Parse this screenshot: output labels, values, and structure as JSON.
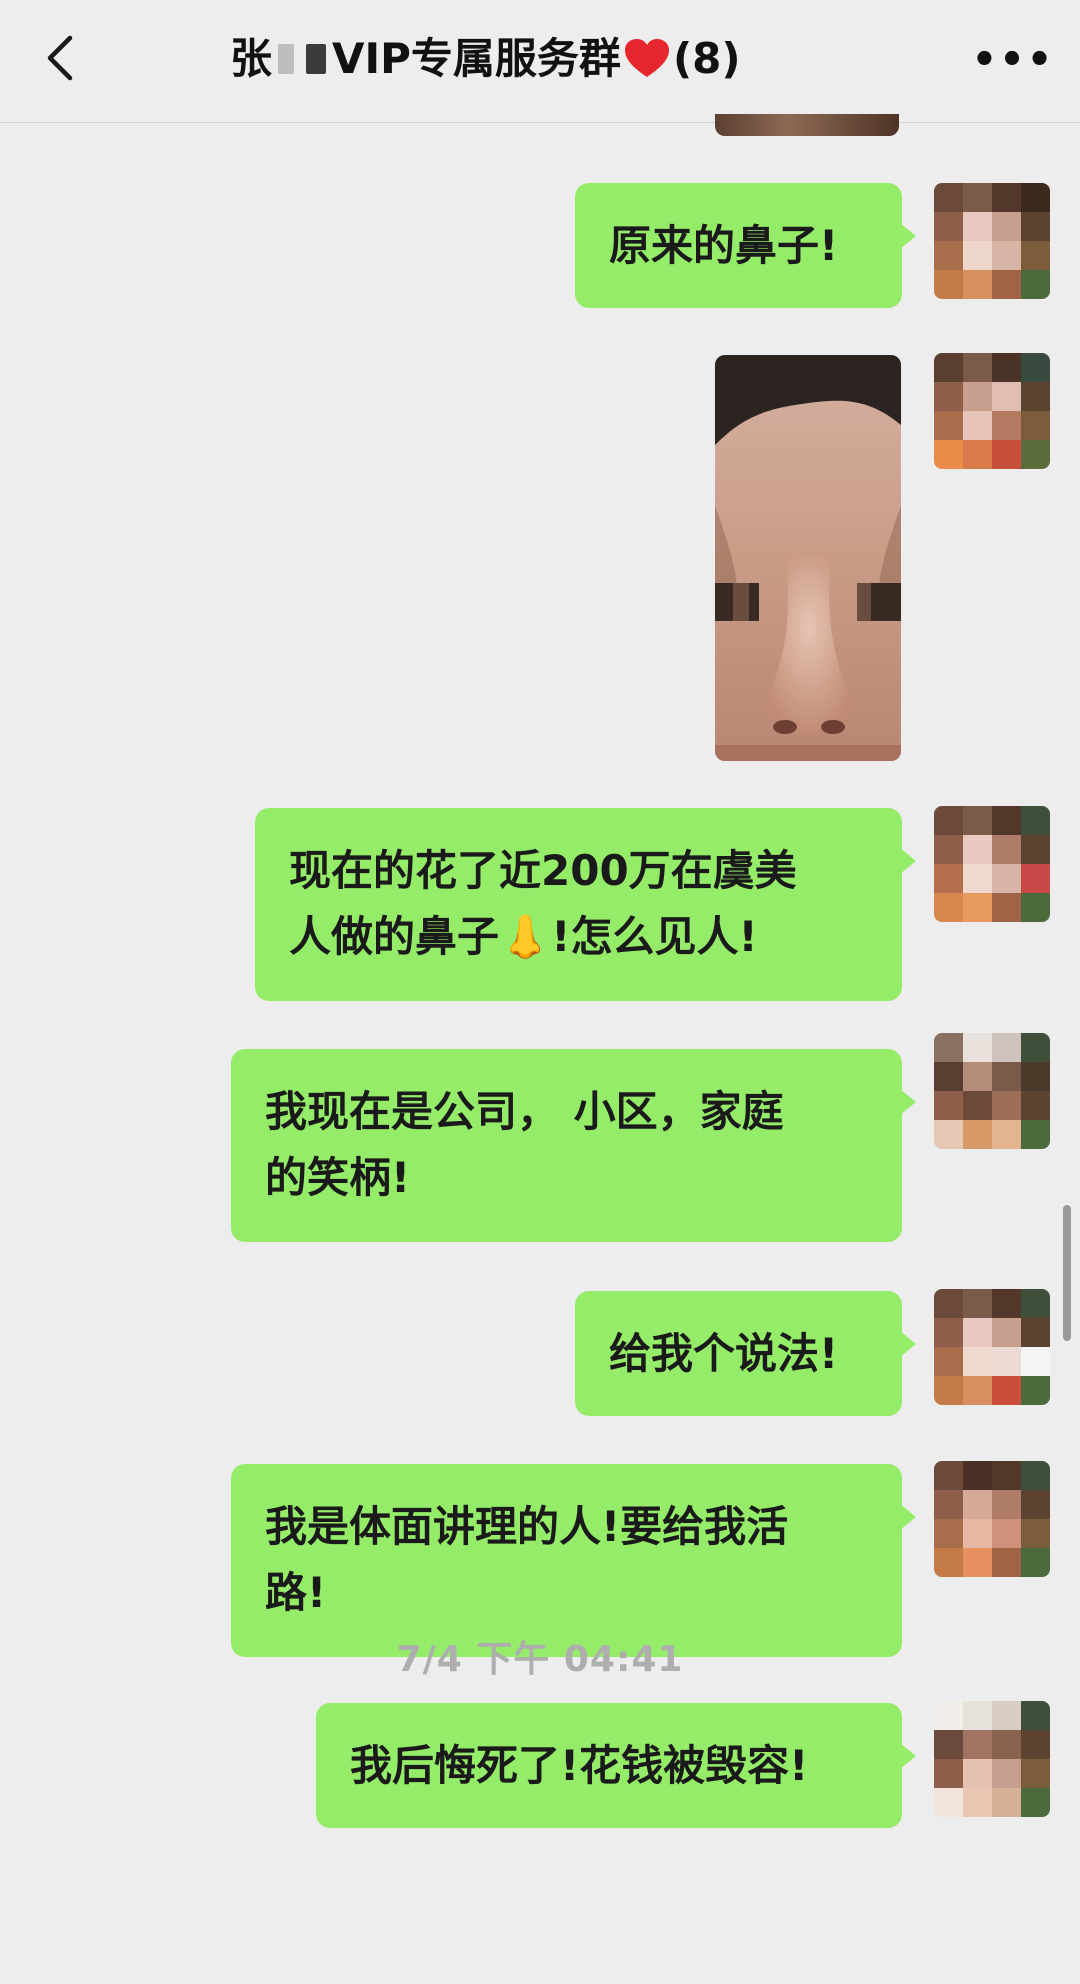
{
  "header": {
    "title_prefix": "张",
    "title_main": "VIP专属服务群",
    "title_count": "(8)",
    "back_icon": "chevron-left-icon",
    "more_label": "•••",
    "heart_color": "#e5262d"
  },
  "colors": {
    "bubble": "#95ec69",
    "background": "#ededed"
  },
  "messages": [
    {
      "type": "text",
      "lines": [
        "原来的鼻子!"
      ]
    },
    {
      "type": "image",
      "icon": "photo-thumbnail"
    },
    {
      "type": "text",
      "lines": [
        "现在的花了近200万在虞美",
        "人做的鼻子👃!怎么见人!"
      ]
    },
    {
      "type": "text",
      "lines": [
        "我现在是公司， 小区，家庭",
        "的笑柄!"
      ]
    },
    {
      "type": "text",
      "lines": [
        "给我个说法!"
      ]
    },
    {
      "type": "text",
      "lines": [
        "我是体面讲理的人!要给我活",
        "路!"
      ]
    },
    {
      "type": "text",
      "lines": [
        "我后悔死了!花钱被毁容!"
      ]
    }
  ],
  "timestamp": "7/4 下午 04:41"
}
